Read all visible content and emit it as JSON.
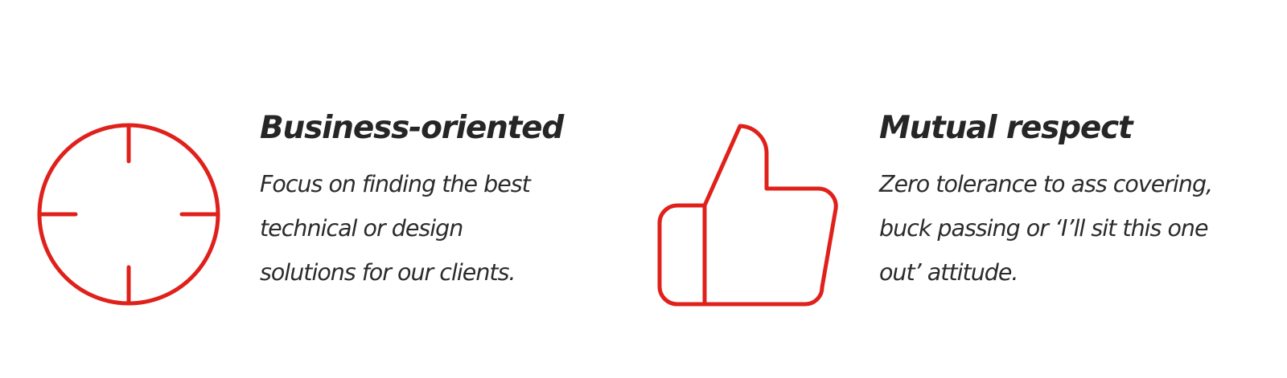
{
  "accent_color": "#e0211b",
  "features": [
    {
      "icon": "crosshair-target-icon",
      "title": "Business-oriented",
      "description_lines": [
        "Focus on finding the best",
        "technical or design",
        "solutions for our clients."
      ]
    },
    {
      "icon": "thumbs-up-icon",
      "title": "Mutual respect",
      "description_lines": [
        "Zero tolerance to ass covering,",
        "buck passing or ‘I’ll sit this one",
        "out’ attitude."
      ]
    }
  ]
}
